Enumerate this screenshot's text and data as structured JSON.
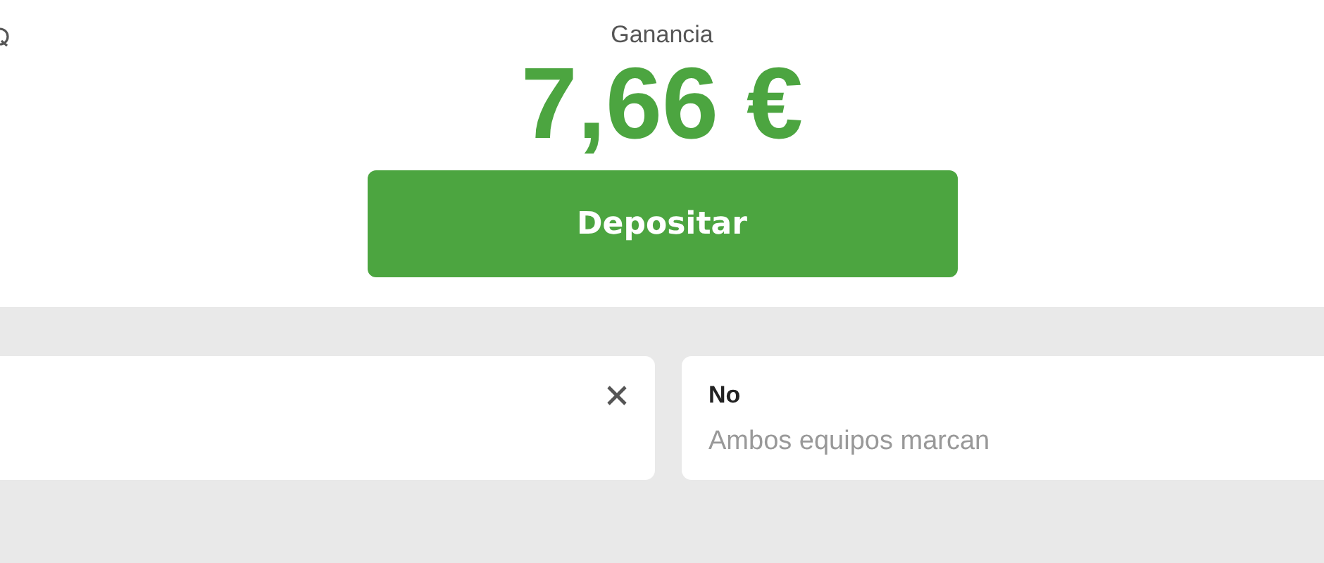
{
  "header": {
    "label": "Ganancia",
    "amount": "7,66 €",
    "button": "Depositar"
  },
  "selections": [
    {
      "kind": "removable"
    },
    {
      "kind": "plain",
      "title": "No",
      "subtitle": "Ambos equipos marcan"
    }
  ]
}
